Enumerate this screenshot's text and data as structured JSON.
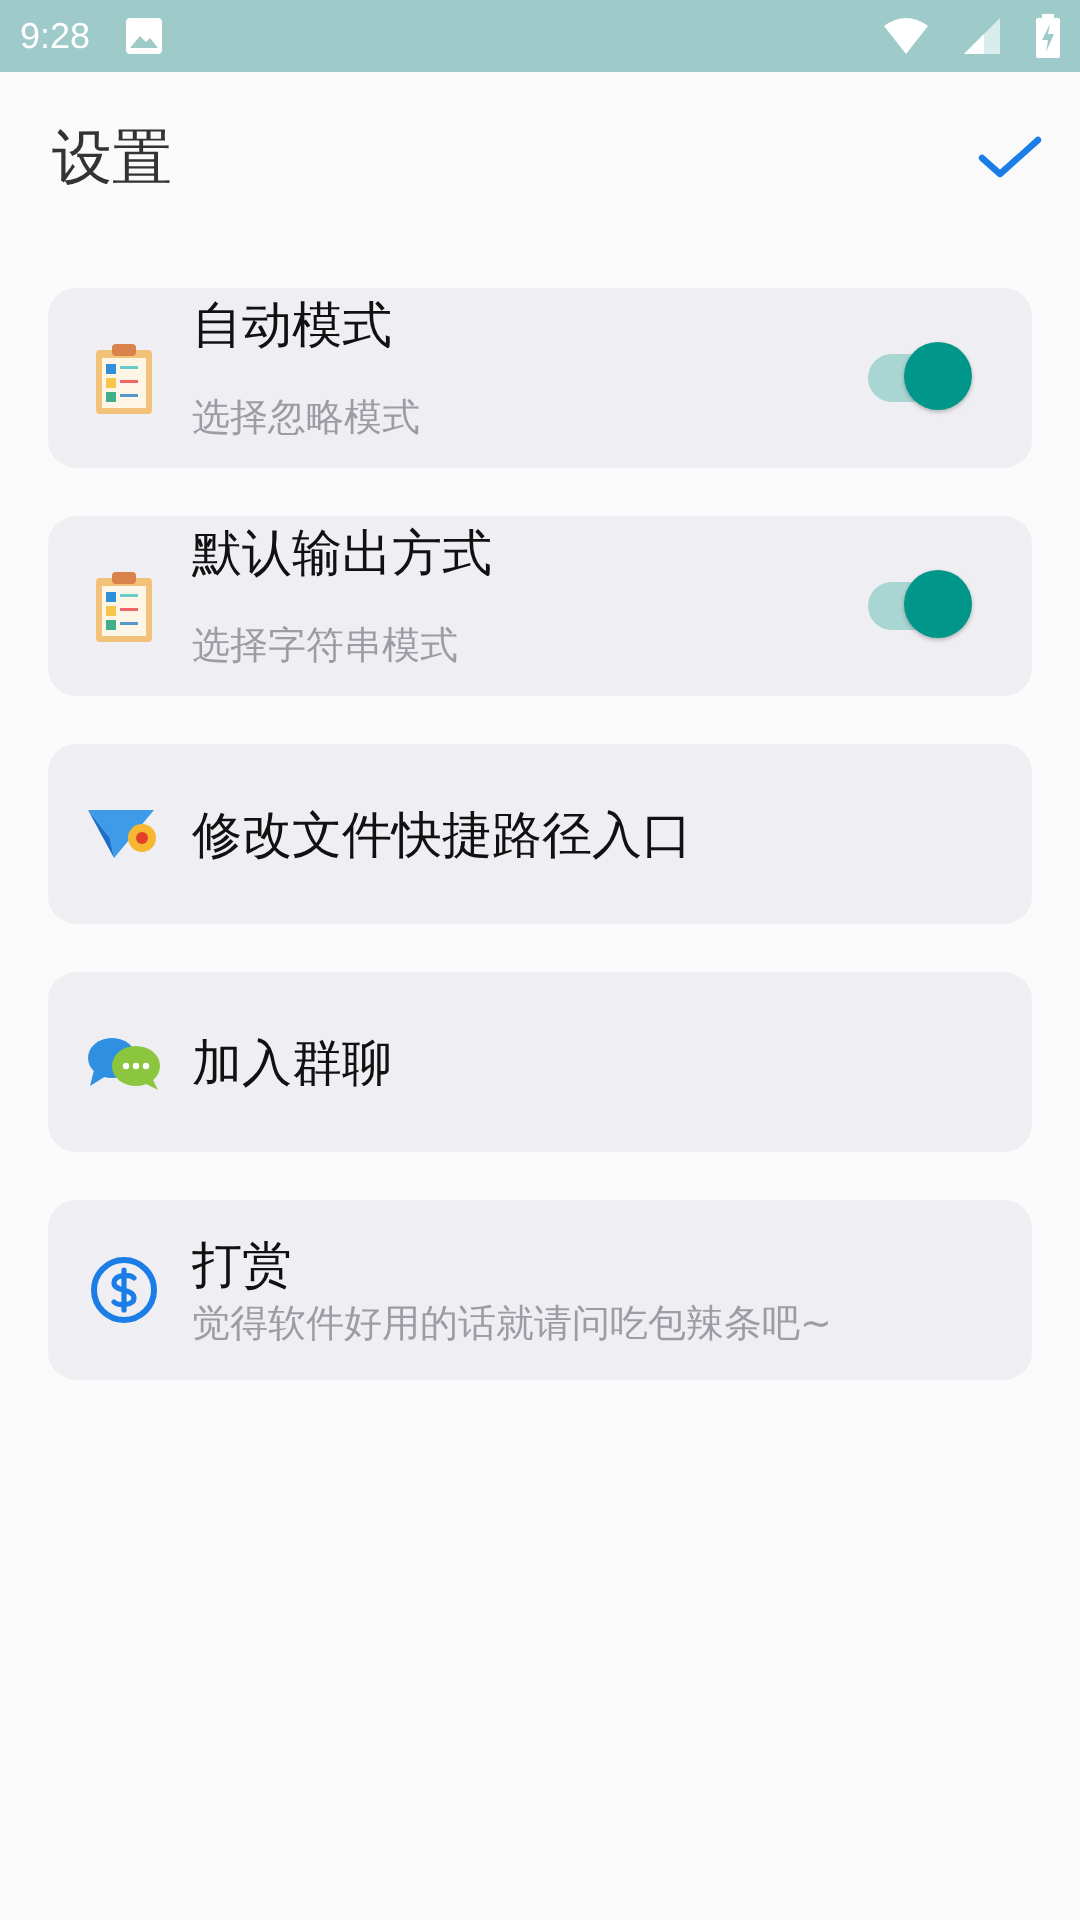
{
  "status_bar": {
    "time": "9:28"
  },
  "header": {
    "title": "设置"
  },
  "items": [
    {
      "kind": "toggle",
      "title": "自动模式",
      "subtitle": "选择忽略模式",
      "on": true
    },
    {
      "kind": "toggle",
      "title": "默认输出方式",
      "subtitle": "选择字符串模式",
      "on": true
    },
    {
      "kind": "link",
      "title": "修改文件快捷路径入口"
    },
    {
      "kind": "link",
      "title": "加入群聊"
    },
    {
      "kind": "link",
      "title": "打赏",
      "subtitle": "觉得软件好用的话就请问吃包辣条吧~"
    }
  ]
}
